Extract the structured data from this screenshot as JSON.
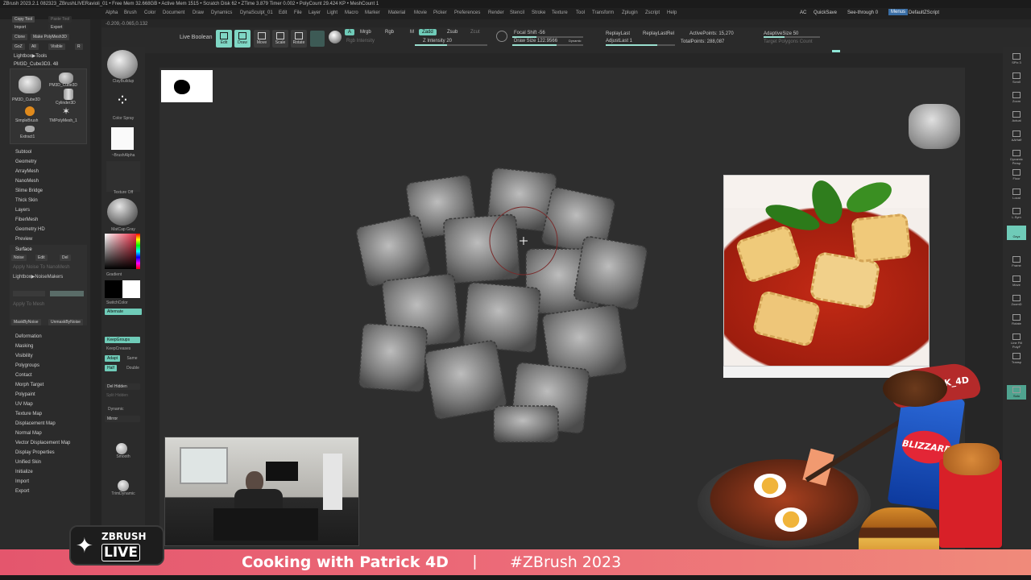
{
  "title_bar": "ZBrush 2023.2.1   082323_ZBrushLIVERavioli_01   • Free Mem 32.668GB • Active Mem 1515 • Scratch Disk 62 • ZTime 3.879 Timer 0.002 • PolyCount 29.424 KP • MeshCount 1",
  "menus": [
    "Alpha",
    "Brush",
    "Color",
    "Document",
    "Draw",
    "Dynamics",
    "DynaSculpt_01",
    "Edit",
    "File",
    "Layer",
    "Light",
    "Macro",
    "Marker",
    "Material",
    "Movie",
    "Picker",
    "Preferences",
    "Render",
    "Stencil",
    "Stroke",
    "Texture",
    "Tool",
    "Transform",
    "Zplugin",
    "Zscript",
    "Help"
  ],
  "menu_right": {
    "ac": "AC",
    "quicksave": "QuickSave",
    "seethrough": "See-through 0",
    "menus": "Menus",
    "script": "DefaultZScript"
  },
  "coords": "-0.209,-0.065,0.132",
  "toolbar": {
    "live_boolean": "Live Boolean",
    "edit": "Edit",
    "draw": "Draw",
    "move": "Move",
    "scale": "Scale",
    "rotate": "Rotate",
    "a": "A",
    "mrgb": "Mrgb",
    "rgb": "Rgb",
    "m": "M",
    "zadd": "Zadd",
    "zsub": "Zsub",
    "zcut": "Zcut",
    "rgb_intensity": "Rgb Intensity",
    "z_intensity": "Z Intensity 20",
    "focal_shift": "Focal Shift -56",
    "draw_size": "Draw Size 122.9566",
    "dynamic": "Dynamic",
    "replay_last": "ReplayLast",
    "replay_last_rel": "ReplayLastRel",
    "adjust_last": "AdjustLast 1",
    "active_points": "ActivePoints: 15,270",
    "total_points": "TotalPoints: 288,087",
    "adaptive_size": "AdaptiveSize 50",
    "target_poly": "Target Polygons Count"
  },
  "left_panel": {
    "top_buttons": [
      "Copy Tool",
      "Paste Tool",
      "Import",
      "Export",
      "Clone",
      "Make PolyMesh3D",
      "GoZ",
      "All",
      "Visible",
      "R"
    ],
    "lightbox_tools": "Lightbox▶Tools",
    "current_tool": "PM3D_Cube3D3. 48",
    "tools": [
      "PM3D_Cube3D",
      "PM3D_Cube3D",
      "Cylinder3D",
      "SimpleBrush",
      "TMPolyMesh_1",
      "Extract1"
    ],
    "subpalettes_a": [
      "Subtool",
      "Geometry",
      "ArrayMesh",
      "NanoMesh",
      "Slime Bridge",
      "Thick Skin",
      "Layers",
      "FiberMesh",
      "Geometry HD",
      "Preview",
      "Surface"
    ],
    "noise_row": [
      "Noise",
      "Edit",
      "Del"
    ],
    "apply_noise": "Apply Noise To NanoMesh",
    "lightbox_noise": "Lightbox▶NoiseMakers",
    "apply_mesh": "Apply To Mesh",
    "mask_row": [
      "MaskByNoise",
      "UnmaskByNoise"
    ],
    "subpalettes_b": [
      "Deformation",
      "Masking",
      "Visibility",
      "Polygroups",
      "Contact",
      "Morph Target",
      "Polypaint",
      "UV Map",
      "Texture Map",
      "Displacement Map",
      "Normal Map",
      "Vector Displacement Map",
      "Display Properties",
      "Unified Skin",
      "Initialize",
      "Import",
      "Export"
    ]
  },
  "shelf": {
    "brush": "ClayBuildup",
    "stroke": "Color Spray",
    "alpha": "~BrushAlpha",
    "texture": "Texture Off",
    "material": "MatCap Gray",
    "gradient": "Gradient",
    "switch_color": "SwitchColor",
    "alternate": "Alternate",
    "keepgroups": "KeepGroups",
    "keepcreases": "KeepCreases",
    "adapt": "Adapt",
    "same": "Same",
    "half": "Half",
    "double": "Double",
    "del_hidden": "Del Hidden",
    "split_hidden": "Split Hidden",
    "dynamic": "Dynamic",
    "mirror": "Mirror",
    "smooth": "Smooth",
    "trim_dynamic": "TrimDynamic"
  },
  "right_shelf": [
    "SPix 3",
    "Scroll",
    "Zoom",
    "Actual",
    "AAHalf",
    "Dynamic Persp",
    "Floor",
    "Local",
    "L.Sym",
    "Gxyz",
    "Frame",
    "Move",
    "ZoomD",
    "Rotate",
    "Line Fill PolyF",
    "Transp",
    "Solo"
  ],
  "banner": {
    "title": "Cooking with Patrick 4D",
    "divider": "|",
    "hashtag": "#ZBrush 2023"
  },
  "logo": {
    "brand": "ZBRUSH",
    "live": "LIVE"
  },
  "promo": {
    "sticker": "@PATRICK_4D",
    "cup": "BLIZZARD"
  },
  "colors": {
    "accent": "#6fcbb8",
    "banner": "#e95c71",
    "bg": "#262626"
  }
}
